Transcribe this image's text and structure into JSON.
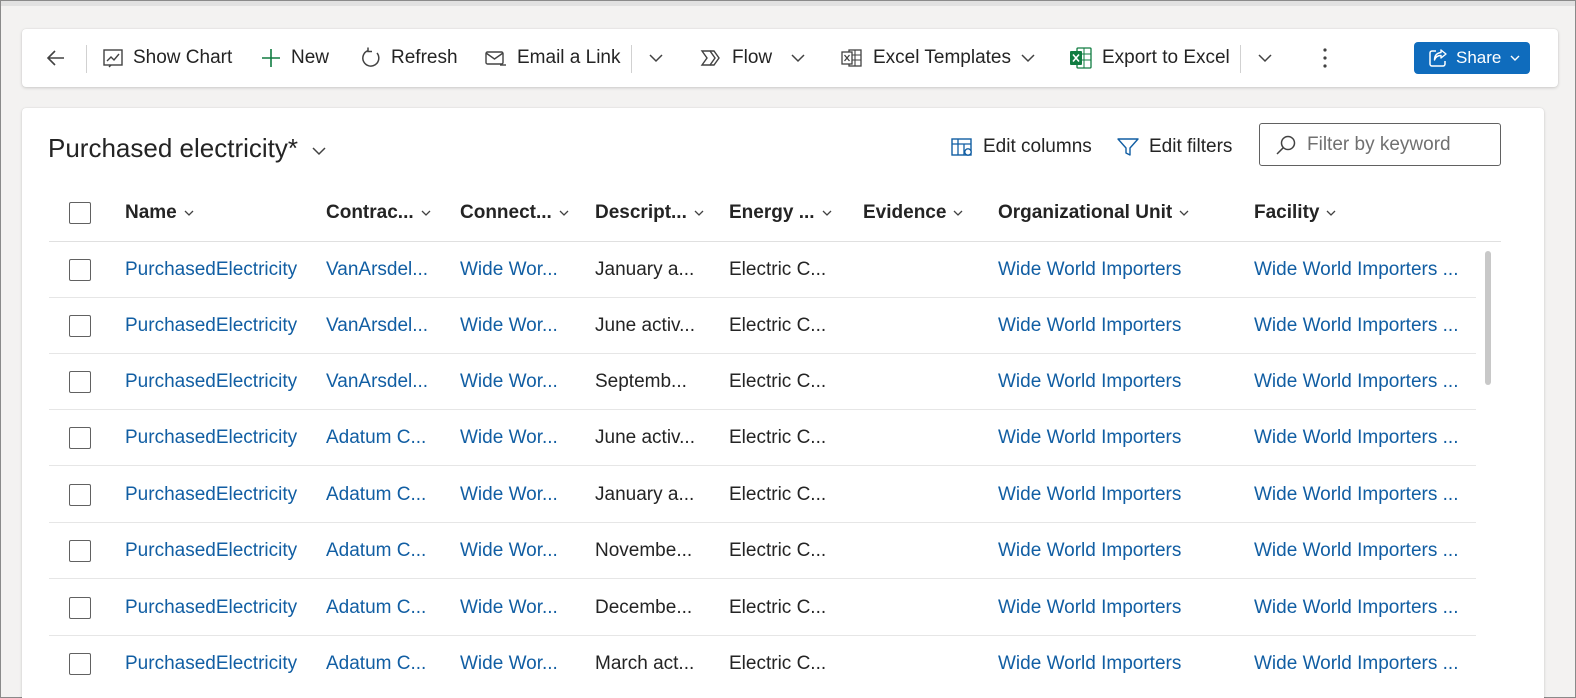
{
  "commandbar": {
    "back_label": "",
    "show_chart": "Show Chart",
    "new": "New",
    "refresh": "Refresh",
    "email_link": "Email a Link",
    "flow": "Flow",
    "excel_templates": "Excel Templates",
    "export_excel": "Export to Excel",
    "share": "Share"
  },
  "view": {
    "title": "Purchased electricity*",
    "edit_columns": "Edit columns",
    "edit_filters": "Edit filters",
    "filter_placeholder": "Filter by keyword"
  },
  "grid": {
    "columns": [
      "Name",
      "Contrac...",
      "Connect...",
      "Descript...",
      "Energy ...",
      "Evidence",
      "Organizational Unit",
      "Facility"
    ],
    "rows": [
      {
        "name": "PurchasedElectricity",
        "contract": "VanArsdel...",
        "connection": "Wide Wor...",
        "description": "January a...",
        "energy": "Electric C...",
        "evidence": "",
        "org_unit": "Wide World Importers",
        "facility": "Wide World Importers ..."
      },
      {
        "name": "PurchasedElectricity",
        "contract": "VanArsdel...",
        "connection": "Wide Wor...",
        "description": "June activ...",
        "energy": "Electric C...",
        "evidence": "",
        "org_unit": "Wide World Importers",
        "facility": "Wide World Importers ..."
      },
      {
        "name": "PurchasedElectricity",
        "contract": "VanArsdel...",
        "connection": "Wide Wor...",
        "description": "Septemb...",
        "energy": "Electric C...",
        "evidence": "",
        "org_unit": "Wide World Importers",
        "facility": "Wide World Importers ..."
      },
      {
        "name": "PurchasedElectricity",
        "contract": "Adatum C...",
        "connection": "Wide Wor...",
        "description": "June activ...",
        "energy": "Electric C...",
        "evidence": "",
        "org_unit": "Wide World Importers",
        "facility": "Wide World Importers ..."
      },
      {
        "name": "PurchasedElectricity",
        "contract": "Adatum C...",
        "connection": "Wide Wor...",
        "description": "January a...",
        "energy": "Electric C...",
        "evidence": "",
        "org_unit": "Wide World Importers",
        "facility": "Wide World Importers ..."
      },
      {
        "name": "PurchasedElectricity",
        "contract": "Adatum C...",
        "connection": "Wide Wor...",
        "description": "Novembe...",
        "energy": "Electric C...",
        "evidence": "",
        "org_unit": "Wide World Importers",
        "facility": "Wide World Importers ..."
      },
      {
        "name": "PurchasedElectricity",
        "contract": "Adatum C...",
        "connection": "Wide Wor...",
        "description": "Decembe...",
        "energy": "Electric C...",
        "evidence": "",
        "org_unit": "Wide World Importers",
        "facility": "Wide World Importers ..."
      },
      {
        "name": "PurchasedElectricity",
        "contract": "Adatum C...",
        "connection": "Wide Wor...",
        "description": "March act...",
        "energy": "Electric C...",
        "evidence": "",
        "org_unit": "Wide World Importers",
        "facility": "Wide World Importers ..."
      }
    ]
  },
  "colors": {
    "accent": "#0f6cbd",
    "link": "#115ea3",
    "excel_green": "#107c41"
  }
}
